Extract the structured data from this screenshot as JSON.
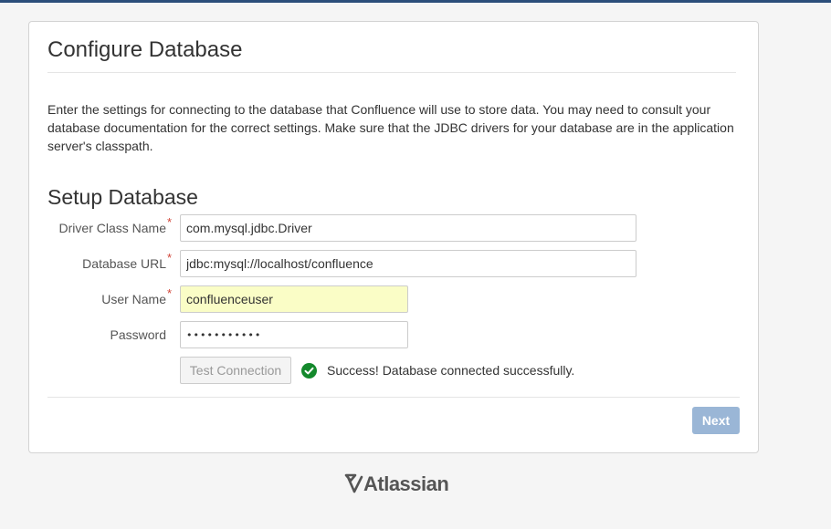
{
  "page": {
    "title": "Configure Database",
    "intro": "Enter the settings for connecting to the database that Confluence will use to store data. You may need to consult your database documentation for the correct settings. Make sure that the JDBC drivers for your database are in the application server's classpath.",
    "section_title": "Setup Database"
  },
  "form": {
    "driver": {
      "label": "Driver Class Name",
      "required": "*",
      "value": "com.mysql.jdbc.Driver"
    },
    "url": {
      "label": "Database URL",
      "required": "*",
      "value": "jdbc:mysql://localhost/confluence"
    },
    "user": {
      "label": "User Name",
      "required": "*",
      "value": "confluenceuser"
    },
    "password": {
      "label": "Password",
      "value": "•••••••••••"
    }
  },
  "test": {
    "button_label": "Test Connection",
    "status_icon": "check-circle-icon",
    "status_color": "#14892c",
    "message": "Success! Database connected successfully."
  },
  "actions": {
    "next_label": "Next",
    "next_color": "#9ab6d6"
  },
  "footer": {
    "brand": "Atlassian",
    "logo_icon": "atlassian-logo-icon"
  },
  "colors": {
    "topbar": "#2c4e7a",
    "required": "#d04437",
    "autofill": "#fafdc6"
  }
}
